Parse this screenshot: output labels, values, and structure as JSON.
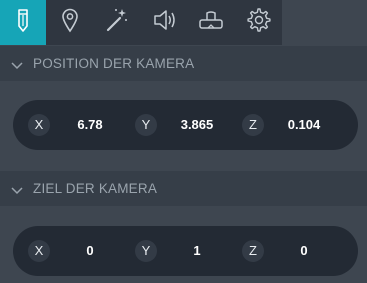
{
  "toolbar": {
    "tools": [
      {
        "icon": "pencil-icon",
        "active": true
      },
      {
        "icon": "map-pin-icon",
        "active": false
      },
      {
        "icon": "magic-wand-icon",
        "active": false
      },
      {
        "icon": "speaker-icon",
        "active": false
      },
      {
        "icon": "vr-headset-icon",
        "active": false
      },
      {
        "icon": "gear-icon",
        "active": false
      }
    ],
    "active_color": "#16a5b7"
  },
  "camera_position": {
    "title": "POSITION DER KAMERA",
    "x_label": "X",
    "x_value": "6.78",
    "y_label": "Y",
    "y_value": "3.865",
    "z_label": "Z",
    "z_value": "0.104"
  },
  "camera_target": {
    "title": "ZIEL DER KAMERA",
    "x_label": "X",
    "x_value": "0",
    "y_label": "Y",
    "y_value": "1",
    "z_label": "Z",
    "z_value": "0"
  }
}
